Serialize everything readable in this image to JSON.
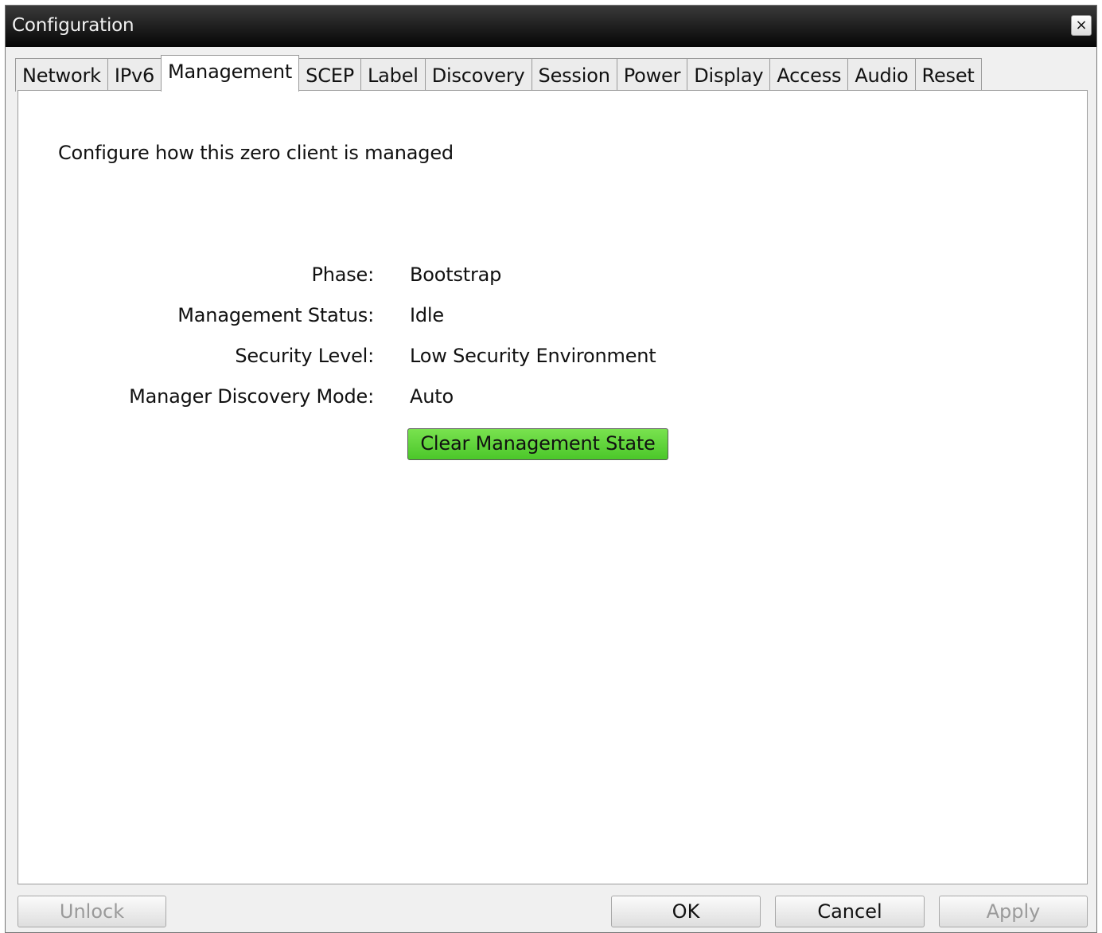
{
  "window": {
    "title": "Configuration",
    "close_glyph": "×"
  },
  "tabs": [
    {
      "label": "Network"
    },
    {
      "label": "IPv6"
    },
    {
      "label": "Management",
      "active": true
    },
    {
      "label": "SCEP"
    },
    {
      "label": "Label"
    },
    {
      "label": "Discovery"
    },
    {
      "label": "Session"
    },
    {
      "label": "Power"
    },
    {
      "label": "Display"
    },
    {
      "label": "Access"
    },
    {
      "label": "Audio"
    },
    {
      "label": "Reset"
    }
  ],
  "management": {
    "description": "Configure how this zero client is managed",
    "fields": [
      {
        "label": "Phase:",
        "value": "Bootstrap"
      },
      {
        "label": "Management Status:",
        "value": "Idle"
      },
      {
        "label": "Security Level:",
        "value": "Low Security Environment"
      },
      {
        "label": "Manager Discovery Mode:",
        "value": "Auto"
      }
    ],
    "clear_button_label": "Clear Management State"
  },
  "footer": {
    "unlock_label": "Unlock",
    "ok_label": "OK",
    "cancel_label": "Cancel",
    "apply_label": "Apply"
  },
  "colors": {
    "titlebar": "#060606",
    "clear_button": "#5fd43a",
    "panel_background": "#ffffff"
  }
}
